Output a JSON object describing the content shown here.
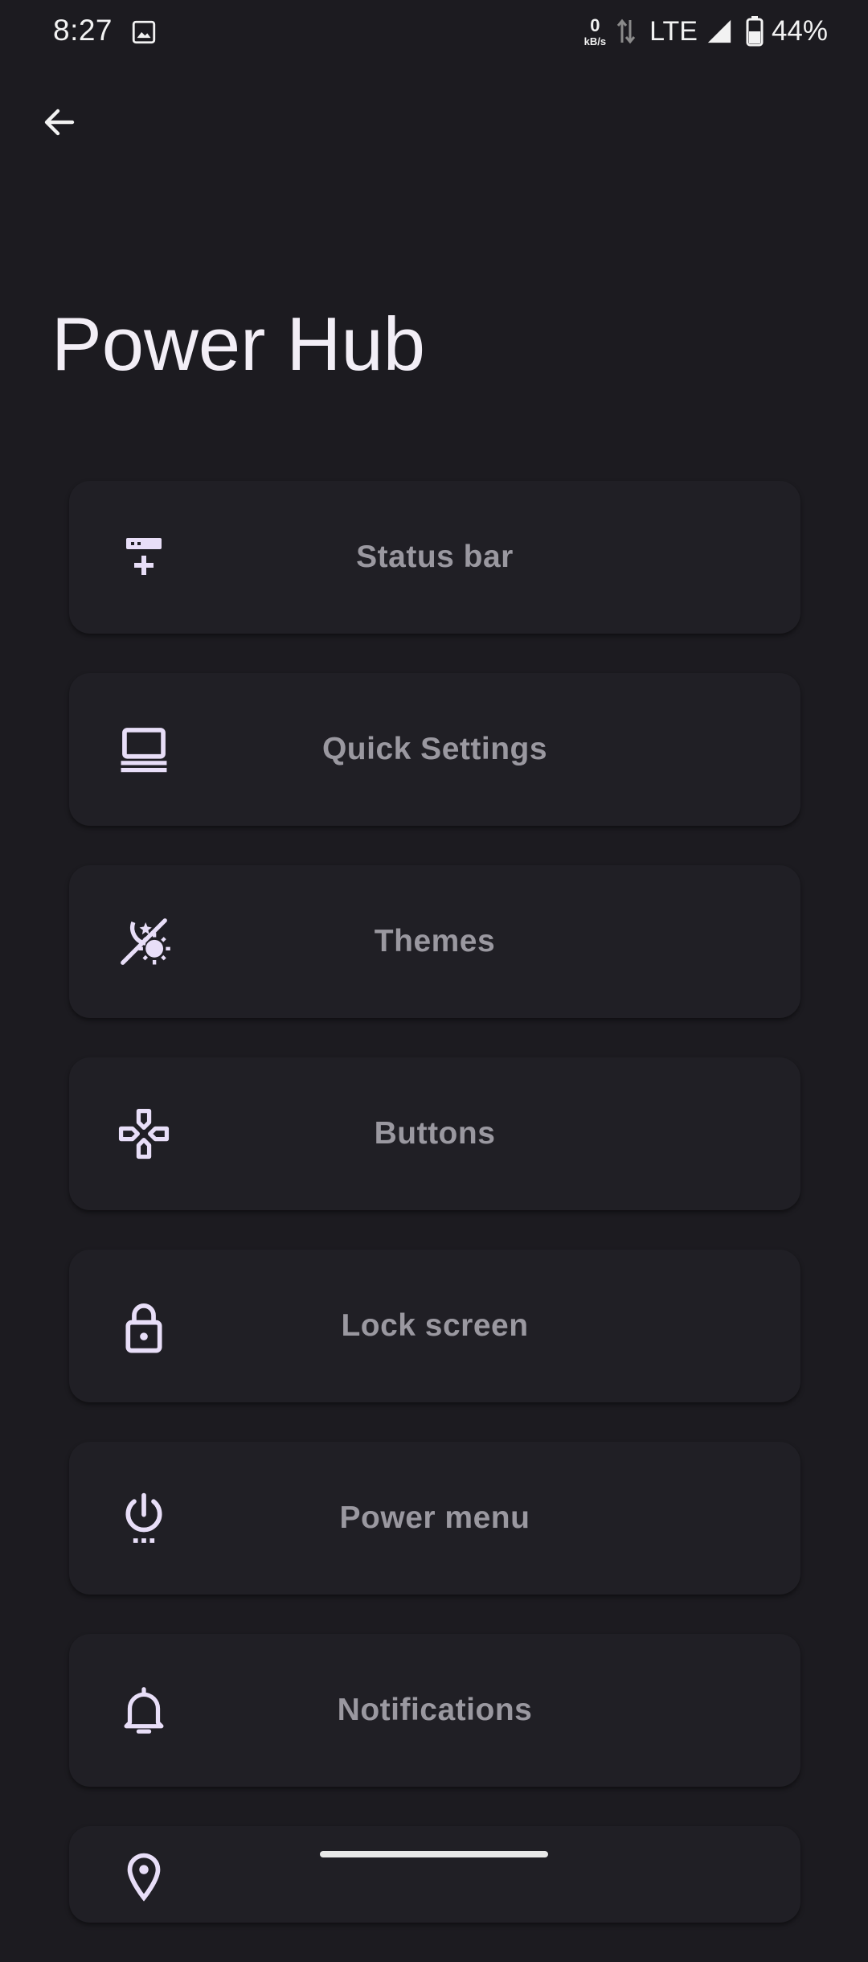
{
  "status_bar": {
    "time": "8:27",
    "net_speed_value": "0",
    "net_speed_unit": "kB/s",
    "network": "LTE",
    "battery_percent": "44%"
  },
  "header": {
    "title": "Power Hub"
  },
  "colors": {
    "background": "#1c1b20",
    "card": "#201f25",
    "icon": "#e8def8",
    "label": "#9a98a0"
  },
  "menu": {
    "items": [
      {
        "label": "Status bar",
        "icon": "status-bar-plus-icon"
      },
      {
        "label": "Quick Settings",
        "icon": "laptop-icon"
      },
      {
        "label": "Themes",
        "icon": "theme-night-day-icon"
      },
      {
        "label": "Buttons",
        "icon": "gamepad-icon"
      },
      {
        "label": "Lock screen",
        "icon": "lock-icon"
      },
      {
        "label": "Power menu",
        "icon": "power-settings-icon"
      },
      {
        "label": "Notifications",
        "icon": "bell-icon"
      },
      {
        "label": "",
        "icon": "location-pin-icon"
      }
    ]
  }
}
